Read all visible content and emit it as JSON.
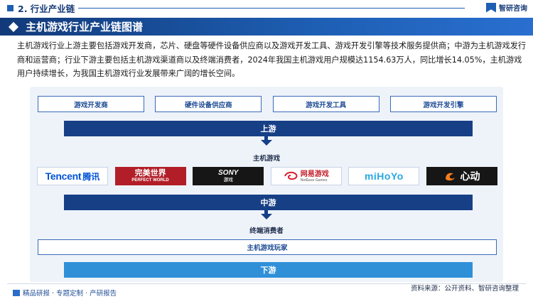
{
  "header": {
    "section": "2. 行业产业链",
    "brand": "智研咨询",
    "title": "主机游戏行业产业链图谱"
  },
  "intro": "主机游戏行业上游主要包括游戏开发商，芯片、硬盘等硬件设备供应商以及游戏开发工具、游戏开发引擎等技术服务提供商；中游为主机游戏发行商和运营商；行业下游主要包括主机游戏渠道商以及终端消费者，2024年我国主机游戏用户规模达1154.63万人，同比增长14.05%，主机游戏用户持续增长，为我国主机游戏行业发展带来广阔的增长空间。",
  "upstream": {
    "boxes": [
      "游戏开发商",
      "硬件设备供应商",
      "游戏开发工具",
      "游戏开发引擎"
    ],
    "label": "上游"
  },
  "midstream": {
    "category": "主机游戏",
    "logos": [
      {
        "main": "Tencent",
        "sub": "腾讯"
      },
      {
        "main": "完美世界",
        "sub": "PERFECT WORLD"
      },
      {
        "main": "SONY",
        "sub": "游戏"
      },
      {
        "main": "网易游戏",
        "sub": "NetEase Games"
      },
      {
        "main": "miHoYo",
        "sub": ""
      },
      {
        "main": "心动",
        "sub": ""
      }
    ],
    "label": "中游"
  },
  "downstream": {
    "category": "终端消费者",
    "box": "主机游戏玩家",
    "label": "下游"
  },
  "footer": {
    "left": "精品研报 · 专题定制 · 产研报告",
    "source": "资料来源：公开资料、智研咨询整理"
  },
  "colors": {
    "primary": "#163f86",
    "accent": "#2f90d8",
    "panel": "#eef3fa"
  }
}
